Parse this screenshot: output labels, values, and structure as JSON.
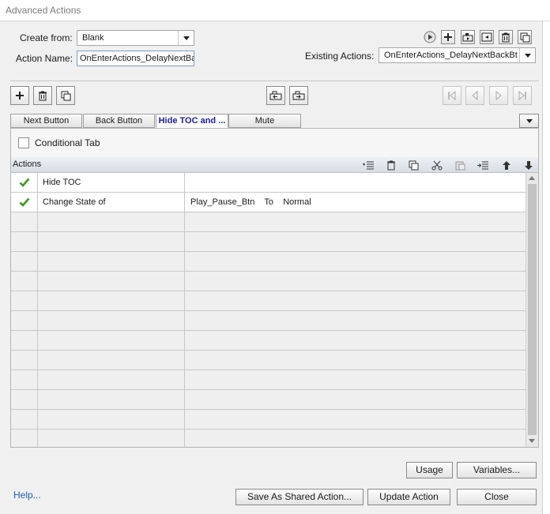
{
  "window": {
    "title": "Advanced Actions"
  },
  "form": {
    "create_from_label": "Create from:",
    "create_from_value": "Blank",
    "action_name_label": "Action Name:",
    "action_name_value": "OnEnterActions_DelayNextBac",
    "existing_actions_label": "Existing Actions:",
    "existing_actions_value": "OnEnterActions_DelayNextBackBt"
  },
  "tabs": [
    {
      "label": "Next Button",
      "active": false
    },
    {
      "label": "Back Button",
      "active": false
    },
    {
      "label": "Hide TOC and ...",
      "active": true
    },
    {
      "label": "Mute",
      "active": false
    }
  ],
  "conditional_tab": {
    "label": "Conditional Tab",
    "checked": false
  },
  "grid": {
    "header": "Actions",
    "rows": [
      {
        "checked": true,
        "action": "Hide TOC",
        "target": ""
      },
      {
        "checked": true,
        "action": "Change State of",
        "target": "Play_Pause_Btn    To    Normal"
      }
    ],
    "empty_rows": 12
  },
  "buttons": {
    "usage": "Usage",
    "variables": "Variables...",
    "save_shared": "Save As Shared Action...",
    "update": "Update Action",
    "close": "Close",
    "help": "Help..."
  },
  "colors": {
    "check": "#3c9a1c",
    "help_link": "#1e5fb0",
    "active_tab_text": "#1a1aa8"
  }
}
